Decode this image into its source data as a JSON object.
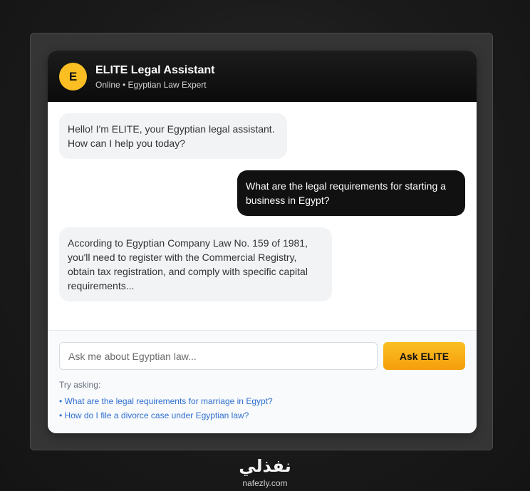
{
  "header": {
    "avatar_letter": "E",
    "title": "ELITE Legal Assistant",
    "subtitle": "Online • Egyptian Law Expert"
  },
  "messages": [
    {
      "role": "assistant",
      "text": "Hello! I'm ELITE, your Egyptian legal assistant. How can I help you today?"
    },
    {
      "role": "user",
      "text": "What are the legal requirements for starting a business in Egypt?"
    },
    {
      "role": "assistant",
      "text": "According to Egyptian Company Law No. 159 of 1981, you'll need to register with the Commercial Registry, obtain tax registration, and comply with specific capital requirements..."
    }
  ],
  "input": {
    "placeholder": "Ask me about Egyptian law...",
    "value": "",
    "button_label": "Ask ELITE"
  },
  "suggestions": {
    "label": "Try asking:",
    "items": [
      "• What are the legal requirements for marriage in Egypt?",
      "• How do I file a divorce case under Egyptian law?"
    ]
  },
  "branding": {
    "arabic": "نفذلي",
    "domain": "nafezly.com"
  },
  "colors": {
    "accent": "#fbbf24",
    "header_bg": "#111111",
    "user_bubble": "#111111",
    "bot_bubble": "#f1f3f5",
    "link": "#2f6fcf"
  }
}
